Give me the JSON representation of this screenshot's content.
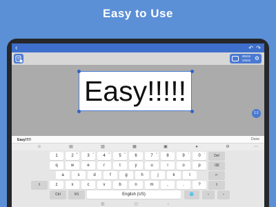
{
  "headline": "Easy to Use",
  "app": {
    "back_icon": "back-arrow-icon",
    "undo_icon": "undo-icon",
    "redo_icon": "redo-icon"
  },
  "toolbar": {
    "tape_width": "45mm",
    "tape_length": "13mm"
  },
  "canvas": {
    "label_text": "Easy!!!!!",
    "zoom_label": "1:1"
  },
  "input": {
    "value": "Easy!!!!!",
    "done_label": "Done"
  },
  "keyboard": {
    "row1": [
      {
        "label": "1",
        "sub": "!"
      },
      {
        "label": "2",
        "sub": "@"
      },
      {
        "label": "3",
        "sub": "#"
      },
      {
        "label": "4",
        "sub": "$"
      },
      {
        "label": "5",
        "sub": "%"
      },
      {
        "label": "6",
        "sub": "^"
      },
      {
        "label": "7",
        "sub": "&"
      },
      {
        "label": "8",
        "sub": "*"
      },
      {
        "label": "9",
        "sub": "("
      },
      {
        "label": "0",
        "sub": ")"
      }
    ],
    "del_label": "Del",
    "row2": [
      "q",
      "w",
      "e",
      "r",
      "t",
      "y",
      "u",
      "i",
      "o",
      "p"
    ],
    "row3": [
      "a",
      "s",
      "d",
      "f",
      "g",
      "h",
      "j",
      "k",
      "l"
    ],
    "row4": [
      "z",
      "x",
      "c",
      "v",
      "b",
      "n",
      "m",
      ",",
      ".",
      "?"
    ],
    "row4_subs": [
      "",
      "",
      "",
      "",
      "",
      "",
      "",
      "",
      "",
      "!"
    ],
    "ctrl_label": "Ctrl",
    "symbols_label": "!#1",
    "space_label": "English (US)"
  }
}
